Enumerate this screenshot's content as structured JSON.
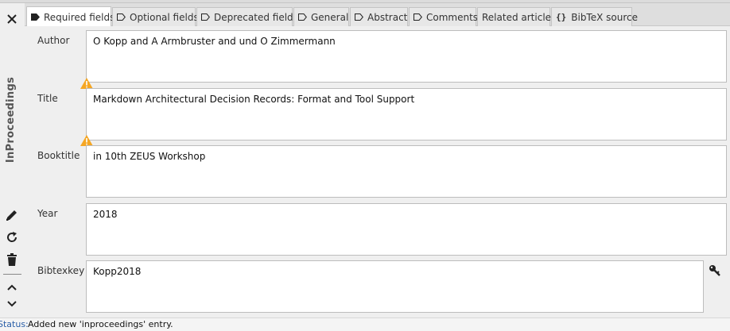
{
  "entry": {
    "type_label": "InProceedings"
  },
  "tabs": [
    {
      "label": "Required fields",
      "icon": "tag-filled-icon",
      "active": true
    },
    {
      "label": "Optional fields",
      "icon": "tag-outline-icon"
    },
    {
      "label": "Deprecated fields",
      "icon": "tag-outline-icon"
    },
    {
      "label": "General",
      "icon": "tag-outline-icon"
    },
    {
      "label": "Abstract",
      "icon": "tag-outline-icon"
    },
    {
      "label": "Comments",
      "icon": "tag-outline-icon"
    },
    {
      "label": "Related articles"
    },
    {
      "label": "BibTeX source",
      "icon": "braces-icon",
      "glyph": "{}"
    }
  ],
  "fields": {
    "author": {
      "label": "Author",
      "value": "O Kopp and A Armbruster and und O Zimmermann"
    },
    "title": {
      "label": "Title",
      "value": "Markdown Architectural Decision Records: Format and Tool Support",
      "warning": true
    },
    "booktitle": {
      "label": "Booktitle",
      "value": "in 10th ZEUS Workshop",
      "warning": true
    },
    "year": {
      "label": "Year",
      "value": "2018"
    },
    "bibtexkey": {
      "label": "Bibtexkey",
      "value": "Kopp2018"
    }
  },
  "status": {
    "label": "Status:",
    "message": "Added new 'inproceedings' entry."
  },
  "colors": {
    "warning": "#f5a623",
    "status_label": "#2a5fa8"
  }
}
